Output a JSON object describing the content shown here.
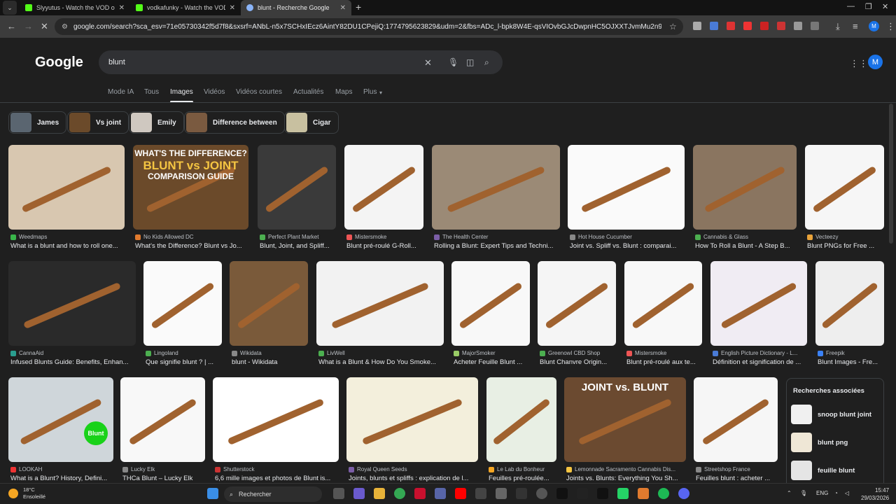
{
  "browser": {
    "tabs": [
      {
        "title": "Slyyutus - Watch the VOD on K",
        "fav_color": "#53fc18"
      },
      {
        "title": "vodkafunky - Watch the VOD o",
        "fav_color": "#53fc18"
      },
      {
        "title": "blunt - Recherche Google",
        "fav_color": "#8ab4f8"
      }
    ],
    "url": "google.com/search?sca_esv=71e05730342f5d7f8&sxsrf=ANbL-n5x7SCHxIEcz6AintY82DU1CPejiQ:1774795623829&udm=2&fbs=ADc_l-bpk8W4E-qsVIOvbGJcDwpnHC5OJXXTJvmMu2n9YYx-G8xzgQk24a...",
    "profile_initial": "M"
  },
  "google": {
    "logo": "Google",
    "query": "blunt",
    "avatar_initial": "M",
    "filters": [
      "Mode IA",
      "Tous",
      "Images",
      "Vidéos",
      "Vidéos courtes",
      "Actualités",
      "Maps",
      "Plus"
    ],
    "active_filter": "Images",
    "chips": [
      "James",
      "Vs joint",
      "Emily",
      "Difference between",
      "Cigar"
    ]
  },
  "results": [
    {
      "source": "Weedmaps",
      "caption": "What is a blunt and how to roll one...",
      "color": "#d8c7b0"
    },
    {
      "source": "No Kids Allowed DC",
      "caption": "What's the Difference? Blunt vs Jo...",
      "color": "#6b4a2a",
      "overlay": [
        "WHAT'S THE DIFFERENCE?",
        "BLUNT vs JOINT",
        "COMPARISON GUIDE"
      ]
    },
    {
      "source": "Perfect Plant Market",
      "caption": "Blunt, Joint, and Spliff...",
      "color": "#3a3a3a"
    },
    {
      "source": "Mistersmoke",
      "caption": "Blunt pré-roulé G-Roll...",
      "color": "#f4f4f4"
    },
    {
      "source": "The Health Center",
      "caption": "Rolling a Blunt: Expert Tips and Techni...",
      "color": "#9b8a76"
    },
    {
      "source": "Hot House Cucumber",
      "caption": "Joint vs. Spliff vs. Blunt : comparai...",
      "color": "#fafafa"
    },
    {
      "source": "Cannabis & Glass",
      "caption": "How To Roll a Blunt - A Step B...",
      "color": "#8a7560"
    },
    {
      "source": "Vecteezy",
      "caption": "Blunt PNGs for Free ...",
      "color": "#f6f6f6"
    },
    {
      "source": "CannaAid",
      "caption": "Infused Blunts Guide: Benefits, Enhan...",
      "color": "#2a2a2a"
    },
    {
      "source": "Lingoland",
      "caption": "Que signifie blunt ? | ...",
      "color": "#fafafa"
    },
    {
      "source": "Wikidata",
      "caption": "blunt - Wikidata",
      "color": "#7a5a3a"
    },
    {
      "source": "LivWell",
      "caption": "What is a Blunt & How Do You Smoke...",
      "color": "#f2f2f2"
    },
    {
      "source": "MajorSmoker",
      "caption": "Acheter Feuille Blunt ...",
      "color": "#f8f8f8"
    },
    {
      "source": "Greenowl CBD Shop",
      "caption": "Blunt Chanvre Origin...",
      "color": "#f5f5f5"
    },
    {
      "source": "Mistersmoke",
      "caption": "Blunt pré-roulé aux te...",
      "color": "#f8f8f8"
    },
    {
      "source": "English Picture Dictionary - L...",
      "caption": "Définition et signification de ...",
      "color": "#f0ecf3"
    },
    {
      "source": "Freepik",
      "caption": "Blunt Images - Fre...",
      "color": "#eeeeee"
    },
    {
      "source": "LOOKAH",
      "caption": "What is a Blunt? History, Defini...",
      "color": "#cfd6da",
      "badge": "Blunt"
    },
    {
      "source": "Lucky Elk",
      "caption": "THCa Blunt – Lucky Elk",
      "color": "#f8f8f8"
    },
    {
      "source": "Shutterstock",
      "caption": "6,6 mille images et photos de Blunt is...",
      "color": "#ffffff"
    },
    {
      "source": "Royal Queen Seeds",
      "caption": "Joints, blunts et spliffs : explication de l...",
      "color": "#f3efdc"
    },
    {
      "source": "Le Lab du Bonheur",
      "caption": "Feuilles pré-roulée...",
      "color": "#e8efe4"
    },
    {
      "source": "Lemonnade Sacramento Cannabis Dis...",
      "caption": "Joints vs. Blunts: Everything You Sh...",
      "color": "#6b4a30",
      "overlay": [
        "JOINT vs. BLUNT"
      ]
    },
    {
      "source": "Streetshop France",
      "caption": "Feuilles blunt : acheter ...",
      "color": "#f6f6f6"
    }
  ],
  "related": {
    "title": "Recherches associées",
    "items": [
      "snoop blunt joint",
      "blunt png",
      "feuille blunt"
    ]
  },
  "taskbar": {
    "temp": "18°C",
    "weather": "Ensoleillé",
    "search_label": "Rechercher",
    "lang": "ENG",
    "time": "15:47",
    "date": "29/03/2026"
  }
}
